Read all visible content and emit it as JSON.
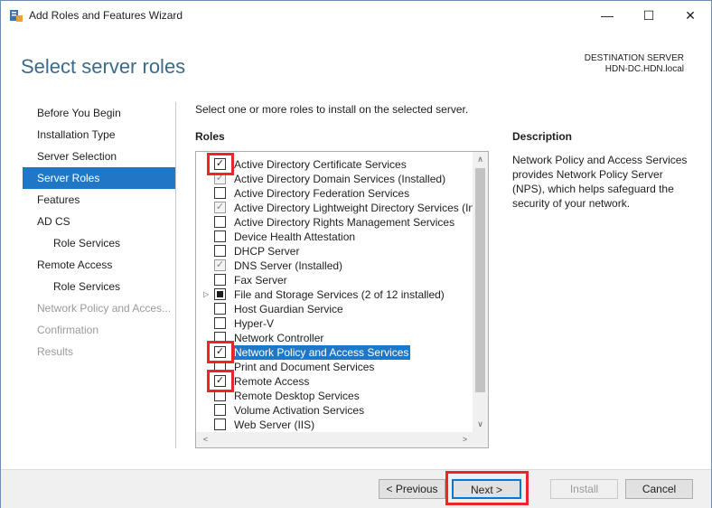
{
  "window": {
    "title": "Add Roles and Features Wizard",
    "controls": {
      "minimize": "—",
      "maximize": "☐",
      "close": "✕"
    }
  },
  "header": {
    "page_title": "Select server roles",
    "destination_label": "DESTINATION SERVER",
    "destination_value": "HDN-DC.HDN.local"
  },
  "nav": {
    "items": [
      {
        "label": "Before You Begin",
        "state": "normal"
      },
      {
        "label": "Installation Type",
        "state": "normal"
      },
      {
        "label": "Server Selection",
        "state": "normal"
      },
      {
        "label": "Server Roles",
        "state": "selected"
      },
      {
        "label": "Features",
        "state": "normal"
      },
      {
        "label": "AD CS",
        "state": "normal"
      },
      {
        "label": "Role Services",
        "state": "normal",
        "sub": true
      },
      {
        "label": "Remote Access",
        "state": "normal"
      },
      {
        "label": "Role Services",
        "state": "normal",
        "sub": true
      },
      {
        "label": "Network Policy and Acces...",
        "state": "disabled"
      },
      {
        "label": "Confirmation",
        "state": "disabled"
      },
      {
        "label": "Results",
        "state": "disabled"
      }
    ]
  },
  "main": {
    "instruction": "Select one or more roles to install on the selected server.",
    "roles_heading": "Roles",
    "roles": [
      {
        "label": "Active Directory Certificate Services",
        "state": "checked"
      },
      {
        "label": "Active Directory Domain Services (Installed)",
        "state": "installed"
      },
      {
        "label": "Active Directory Federation Services",
        "state": "unchecked"
      },
      {
        "label": "Active Directory Lightweight Directory Services (In",
        "state": "installed"
      },
      {
        "label": "Active Directory Rights Management Services",
        "state": "unchecked"
      },
      {
        "label": "Device Health Attestation",
        "state": "unchecked"
      },
      {
        "label": "DHCP Server",
        "state": "unchecked"
      },
      {
        "label": "DNS Server (Installed)",
        "state": "installed"
      },
      {
        "label": "Fax Server",
        "state": "unchecked"
      },
      {
        "label": "File and Storage Services (2 of 12 installed)",
        "state": "partial",
        "expandable": true
      },
      {
        "label": "Host Guardian Service",
        "state": "unchecked"
      },
      {
        "label": "Hyper-V",
        "state": "unchecked"
      },
      {
        "label": "Network Controller",
        "state": "unchecked"
      },
      {
        "label": "Network Policy and Access Services",
        "state": "checked",
        "selected": true
      },
      {
        "label": "Print and Document Services",
        "state": "unchecked"
      },
      {
        "label": "Remote Access",
        "state": "checked"
      },
      {
        "label": "Remote Desktop Services",
        "state": "unchecked"
      },
      {
        "label": "Volume Activation Services",
        "state": "unchecked"
      },
      {
        "label": "Web Server (IIS)",
        "state": "unchecked"
      }
    ],
    "description_heading": "Description",
    "description_text": "Network Policy and Access Services provides Network Policy Server (NPS), which helps safeguard the security of your network.",
    "scroll_arrows": {
      "up": "∧",
      "down": "∨",
      "left": "<",
      "right": ">"
    }
  },
  "footer": {
    "previous": "< Previous",
    "next": "Next >",
    "install": "Install",
    "cancel": "Cancel"
  },
  "colors": {
    "accent": "#1f77c5",
    "title_blue": "#3b6b8c",
    "highlight_red": "#e8262b"
  }
}
